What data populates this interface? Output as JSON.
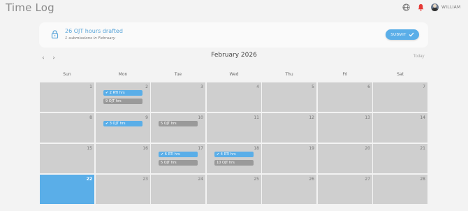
{
  "header": {
    "title": "Time Log",
    "user_name": "WILLIAM",
    "globe_icon": "globe-icon",
    "bell_icon": "bell-icon",
    "bell_color": "#e53935"
  },
  "banner": {
    "title": "26 OJT hours drafted",
    "subtitle": "1 submissions in February",
    "submit_label": "SUBMIT",
    "submit_icon": "check-icon",
    "lock_icon": "lock-icon"
  },
  "calendar": {
    "month_label": "February 2026",
    "prev_label": "‹",
    "next_label": "›",
    "today_label": "Today",
    "weekdays": [
      "Sun",
      "Mon",
      "Tue",
      "Wed",
      "Thu",
      "Fri",
      "Sat"
    ],
    "days": [
      "1",
      "2",
      "3",
      "4",
      "5",
      "6",
      "7",
      "8",
      "9",
      "10",
      "11",
      "12",
      "13",
      "14",
      "15",
      "16",
      "17",
      "18",
      "19",
      "20",
      "21",
      "22",
      "23",
      "24",
      "25",
      "26",
      "27",
      "28"
    ],
    "today_day": "22",
    "entries": {
      "d2_a": "✔ 2 RTI hrs",
      "d2_b": "9 OJT hrs",
      "d9_a": "✔ 3 OJT hrs",
      "d10_a": "5 OJT hrs",
      "d17_a": "✔ 6 RTI hrs",
      "d17_b": "5 OJT hrs",
      "d18_a": "✔ 4 RTI hrs",
      "d18_b": "10 OJT hrs"
    },
    "colors": {
      "submitted": "#5aaee8",
      "draft": "#9a9a9a",
      "today": "#5aaee8"
    }
  }
}
